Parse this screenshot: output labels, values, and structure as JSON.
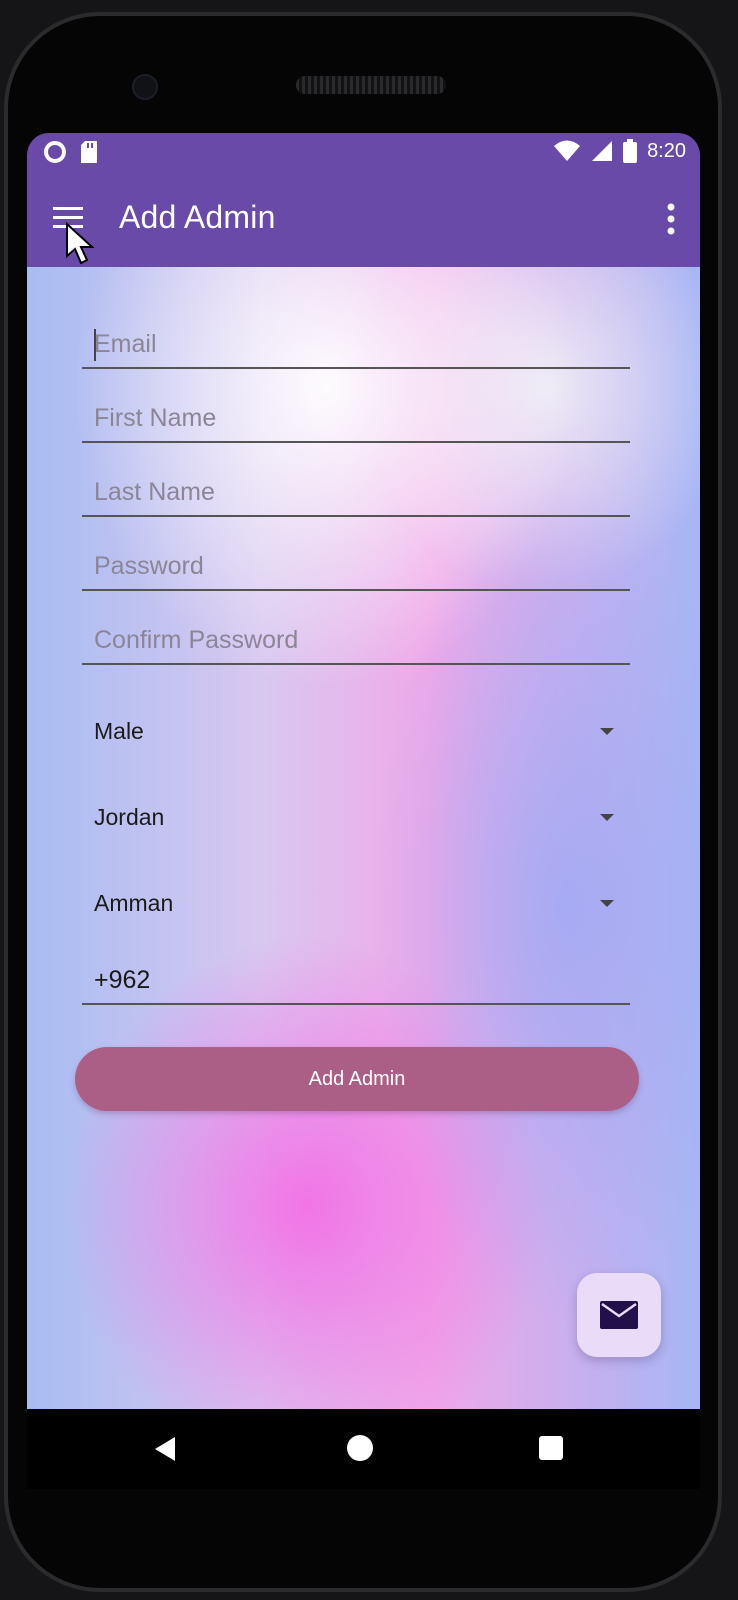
{
  "status_bar": {
    "time": "8:20",
    "left_icons": [
      "circle-notification-icon",
      "sd-card-icon"
    ],
    "right_icons": [
      "wifi-icon",
      "signal-icon",
      "battery-icon"
    ]
  },
  "app_bar": {
    "title": "Add Admin",
    "menu_icon": "hamburger-menu-icon",
    "overflow_icon": "more-vert-icon",
    "color": "#6a4aa8"
  },
  "form": {
    "email": {
      "placeholder": "Email",
      "value": ""
    },
    "first_name": {
      "placeholder": "First Name",
      "value": ""
    },
    "last_name": {
      "placeholder": "Last Name",
      "value": ""
    },
    "password": {
      "placeholder": "Password",
      "value": ""
    },
    "confirm_password": {
      "placeholder": "Confirm Password",
      "value": ""
    },
    "gender": {
      "selected": "Male"
    },
    "country": {
      "selected": "Jordan"
    },
    "city": {
      "selected": "Amman"
    },
    "phone": {
      "value": "+962"
    },
    "submit_label": "Add Admin",
    "submit_color": "#ac5f86"
  },
  "fab": {
    "icon": "mail-icon",
    "color": "#eadcf8"
  },
  "nav_bar": {
    "icons": [
      "back-icon",
      "home-icon",
      "recents-icon"
    ]
  }
}
